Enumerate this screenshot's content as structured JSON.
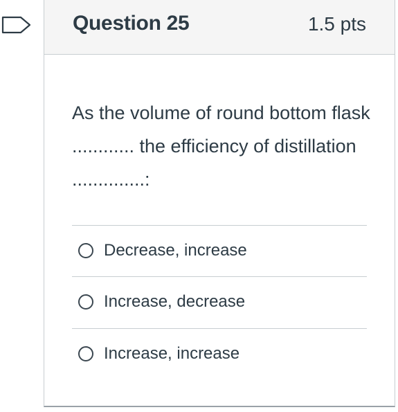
{
  "question": {
    "title": "Question 25",
    "points": "1.5 pts",
    "text": "As the volume of round bottom flask ............ the efficiency of distillation ..............:"
  },
  "answers": [
    {
      "label": "Decrease, increase",
      "selected": false
    },
    {
      "label": "Increase, decrease",
      "selected": false
    },
    {
      "label": "Increase, increase",
      "selected": false
    }
  ],
  "icons": {
    "flag": "bookmark-flag-icon",
    "radio": "radio-button-icon"
  },
  "colors": {
    "text": "#2d3b45",
    "header_bg": "#f5f5f5",
    "border": "#c7cdd1"
  }
}
